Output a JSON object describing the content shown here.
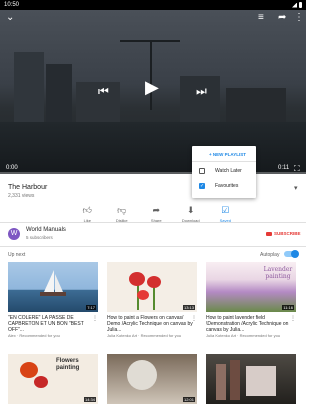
{
  "status_bar": {
    "time": "10:50"
  },
  "player": {
    "current_time": "0:00",
    "total_time": "0:11",
    "progress": 0
  },
  "video": {
    "title": "The Harbour",
    "views": "2,331 views"
  },
  "actions": [
    {
      "label": "Like",
      "icon": "thumbs-up-icon"
    },
    {
      "label": "Dislike",
      "icon": "thumbs-down-icon"
    },
    {
      "label": "Share",
      "icon": "share-icon"
    },
    {
      "label": "Download",
      "icon": "download-icon"
    },
    {
      "label": "Saved",
      "icon": "saved-icon"
    }
  ],
  "channel": {
    "avatar_letter": "W",
    "name": "World Manuals",
    "subscribers": "5 subscribers",
    "subscribe_label": "SUBSCRIBE"
  },
  "up_next": {
    "label": "Up next",
    "autoplay_label": "Autoplay",
    "autoplay_on": true
  },
  "cards": [
    {
      "title": "\"EN COLÈRE\" LA PASSE DE CAPBRETON ET UN BON \"BEST OFF\"...",
      "meta": "Alex · Recommended for you",
      "duration": "7:17"
    },
    {
      "title": "How to paint a Flowers on canvas/ Demo /Acrylic Technique on canvas by Julia...",
      "meta": "Julia Kotenko Art · Recommended for you",
      "duration": "13:13"
    },
    {
      "title": "How to paint lavender field \\Demonstration /Acrylic Technique on canvas by Julia...",
      "meta": "Julia Kotenko Art · Recommended for you",
      "duration": "11:16"
    },
    {
      "title": "",
      "meta": "",
      "duration": "14:34"
    },
    {
      "title": "",
      "meta": "",
      "duration": "12:01"
    },
    {
      "title": "",
      "meta": "",
      "duration": ""
    }
  ],
  "thumb_text": {
    "lavender": "Lavender painting",
    "flowers": "Flowers painting"
  },
  "playlist_popup": {
    "new_playlist": "+ NEW PLAYLIST",
    "items": [
      {
        "label": "Watch Later",
        "checked": false
      },
      {
        "label": "Favourites",
        "checked": true
      }
    ]
  },
  "colors": {
    "accent": "#1e88e5",
    "subscribe": "#e53935",
    "progress": "#ff0000"
  }
}
